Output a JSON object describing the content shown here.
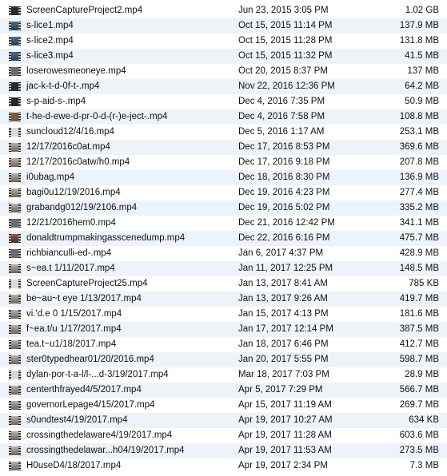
{
  "files": [
    {
      "name": "ScreenCaptureProject2.mp4",
      "date": "Jun 23, 2015 3:05 PM",
      "size": "1.02 GB",
      "icon": "video-thumbnail-icon",
      "tone": "t-dark"
    },
    {
      "name": "s-lice1.mp4",
      "date": "Oct 15, 2015 11:14 PM",
      "size": "137.9 MB",
      "icon": "video-thumbnail-icon",
      "tone": "t-blue"
    },
    {
      "name": "s-lice2.mp4",
      "date": "Oct 15, 2015 11:28 PM",
      "size": "131.8 MB",
      "icon": "video-thumbnail-icon",
      "tone": "t-blue"
    },
    {
      "name": "s-lice3.mp4",
      "date": "Oct 15, 2015 11:32 PM",
      "size": "41.5 MB",
      "icon": "video-thumbnail-icon",
      "tone": "t-blue"
    },
    {
      "name": "loserowesmeoneye.mp4",
      "date": "Oct 20, 2015 8:37 PM",
      "size": "137 MB",
      "icon": "video-thumbnail-icon",
      "tone": "t-mid"
    },
    {
      "name": "jac-k-t-d-0f-t-.mp4",
      "date": "Nov 22, 2016 12:36 PM",
      "size": "64.2 MB",
      "icon": "video-thumbnail-icon",
      "tone": "t-dark"
    },
    {
      "name": "s-p-aid-s-.mp4",
      "date": "Dec 4, 2016 7:35 PM",
      "size": "50.9 MB",
      "icon": "video-thumbnail-icon",
      "tone": "t-dark"
    },
    {
      "name": "t-he-d-ewe-d-pr-0-d-(r-)e-ject-.mp4",
      "date": "Dec 4, 2016 7:58 PM",
      "size": "108.8 MB",
      "icon": "video-thumbnail-icon",
      "tone": "t-brown"
    },
    {
      "name": "suncloud12/4/16.mp4",
      "date": "Dec 5, 2016 1:17 AM",
      "size": "253.1 MB",
      "icon": "video-thumbnail-icon",
      "tone": "t-light"
    },
    {
      "name": "12/17/2016c0at.mp4",
      "date": "Dec 17, 2016 8:53 PM",
      "size": "369.6 MB",
      "icon": "video-thumbnail-icon",
      "tone": "t-scene"
    },
    {
      "name": "12/17/2016c0atw/h0.mp4",
      "date": "Dec 17, 2016 9:18 PM",
      "size": "207.8 MB",
      "icon": "video-thumbnail-icon",
      "tone": "t-scene"
    },
    {
      "name": "i0ubag.mp4",
      "date": "Dec 18, 2016 8:30 PM",
      "size": "136.9 MB",
      "icon": "video-thumbnail-icon",
      "tone": "t-scene"
    },
    {
      "name": "bagi0u12/19/2016.mp4",
      "date": "Dec 19, 2016 4:23 PM",
      "size": "277.4 MB",
      "icon": "video-thumbnail-icon",
      "tone": "t-scene"
    },
    {
      "name": "grabandg012/19/2106.mp4",
      "date": "Dec 19, 2016 5:02 PM",
      "size": "335.2 MB",
      "icon": "video-thumbnail-icon",
      "tone": "t-scene"
    },
    {
      "name": "12/21/2016hem0.mp4",
      "date": "Dec 21, 2016 12:42 PM",
      "size": "341.1 MB",
      "icon": "video-thumbnail-icon",
      "tone": "t-mid"
    },
    {
      "name": "donaldtrumpmakingasscenedump.mp4",
      "date": "Dec 22, 2016 6:16 PM",
      "size": "475.7 MB",
      "icon": "video-thumbnail-icon",
      "tone": "t-red"
    },
    {
      "name": "richbianculli-ed-.mp4",
      "date": "Jan 6, 2017 4:37 PM",
      "size": "428.9 MB",
      "icon": "video-thumbnail-icon",
      "tone": "t-mid"
    },
    {
      "name": "s~ea.t 1/11/2017.mp4",
      "date": "Jan 11, 2017 12:25 PM",
      "size": "148.5 MB",
      "icon": "video-thumbnail-icon",
      "tone": "t-scene"
    },
    {
      "name": "ScreenCaptureProject25.mp4",
      "date": "Jan 13, 2017 8:41 AM",
      "size": "785 KB",
      "icon": "video-thumbnail-icon",
      "tone": "t-light"
    },
    {
      "name": "be~au~t eye 1/13/2017.mp4",
      "date": "Jan 13, 2017 9:26 AM",
      "size": "419.7 MB",
      "icon": "video-thumbnail-icon",
      "tone": "t-scene"
    },
    {
      "name": "vi.'d.e 0 1/15/2017.mp4",
      "date": "Jan 15, 2017 4:13 PM",
      "size": "181.6 MB",
      "icon": "video-thumbnail-icon",
      "tone": "t-scene"
    },
    {
      "name": "f~ea.t/u 1/17/2017.mp4",
      "date": "Jan 17, 2017 12:14 PM",
      "size": "387.5 MB",
      "icon": "video-thumbnail-icon",
      "tone": "t-scene"
    },
    {
      "name": "tea.t~u1/18/2017.mp4",
      "date": "Jan 18, 2017 6:46 PM",
      "size": "412.7 MB",
      "icon": "video-thumbnail-icon",
      "tone": "t-scene"
    },
    {
      "name": "ster0typedhear01/20/2016.mp4",
      "date": "Jan 20, 2017 5:55 PM",
      "size": "598.7 MB",
      "icon": "video-thumbnail-icon",
      "tone": "t-scene"
    },
    {
      "name": "dylan-por-t-a-l/l-...d-3/19/2017.mp4",
      "date": "Mar 18, 2017 7:03 PM",
      "size": "28.9 MB",
      "icon": "video-thumbnail-icon",
      "tone": "t-light"
    },
    {
      "name": "centerthfrayed4/5/2017.mp4",
      "date": "Apr 5, 2017 7:29 PM",
      "size": "566.7 MB",
      "icon": "video-thumbnail-icon",
      "tone": "t-scene"
    },
    {
      "name": "governorLepage4/15/2017.mp4",
      "date": "Apr 15, 2017 11:19 AM",
      "size": "269.7 MB",
      "icon": "video-thumbnail-icon",
      "tone": "t-scene"
    },
    {
      "name": "s0undtest4/19/2017.mp4",
      "date": "Apr 19, 2017 10:27 AM",
      "size": "634 KB",
      "icon": "video-thumbnail-icon",
      "tone": "t-scene"
    },
    {
      "name": "crossingthedelaware4/19/2017.mp4",
      "date": "Apr 19, 2017 11:28 AM",
      "size": "603.6 MB",
      "icon": "video-thumbnail-icon",
      "tone": "t-scene"
    },
    {
      "name": "crossingthedelawar...h04/19/2017.mp4",
      "date": "Apr 19, 2017 11:53 AM",
      "size": "273.5 MB",
      "icon": "video-thumbnail-icon",
      "tone": "t-scene"
    },
    {
      "name": "H0useD4/18/2017.mp4",
      "date": "Apr 19, 2017 2:34 PM",
      "size": "7.3 MB",
      "icon": "video-thumbnail-icon",
      "tone": "t-scene"
    }
  ],
  "colors": {
    "row_alt": "#eef3fa",
    "background": "#ffffff",
    "text": "#111111"
  }
}
